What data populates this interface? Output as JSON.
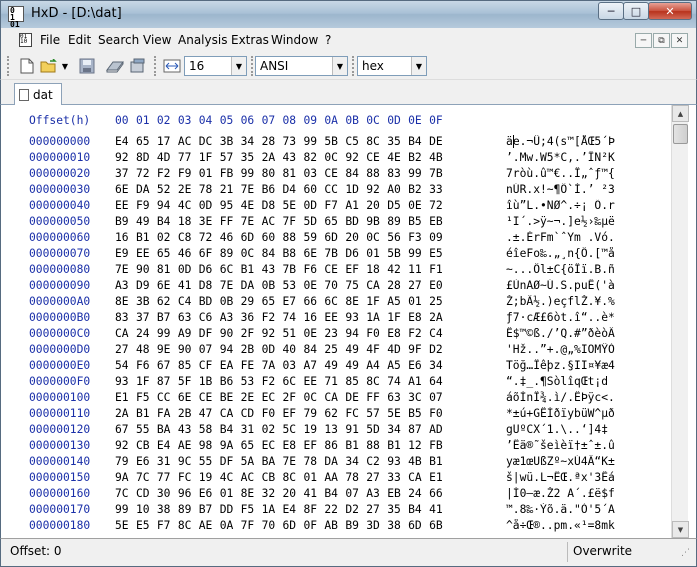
{
  "window": {
    "title": "HxD - [D:\\dat]"
  },
  "menu": [
    "File",
    "Edit",
    "Search",
    "View",
    "Analysis",
    "Extras",
    "Window",
    "?"
  ],
  "toolbar": {
    "bytes_per_row": "16",
    "charset": "ANSI",
    "offset_base": "hex"
  },
  "tabs": [
    {
      "label": "dat"
    }
  ],
  "editor": {
    "offset_header": "Offset(h)",
    "column_headers": [
      "00",
      "01",
      "02",
      "03",
      "04",
      "05",
      "06",
      "07",
      "08",
      "09",
      "0A",
      "0B",
      "0C",
      "0D",
      "0E",
      "0F"
    ],
    "rows": [
      {
        "offset": "000000000",
        "hex": "E4 65 17 AC DC 3B 34 28 73 99 5B C5 8C 35 B4 DE",
        "text": "äe.¬Ü;4(s™[ÅŒ5´Þ"
      },
      {
        "offset": "000000010",
        "hex": "92 8D 4D 77 1F 57 35 2A 43 82 0C 92 CE 4E B2 4B",
        "text": "’.Mw.W5*C‚.’ÎN²K"
      },
      {
        "offset": "000000020",
        "hex": "37 72 F2 F9 01 FB 99 80 81 03 CE 84 88 83 99 7B",
        "text": "7ròù.û™€..Î„ˆƒ™{"
      },
      {
        "offset": "000000030",
        "hex": "6E DA 52 2E 78 21 7E B6 D4 60 CC 1D 92 A0 B2 33",
        "text": "nÚR.x!~¶Ô`Ì.’ ²3"
      },
      {
        "offset": "000000040",
        "hex": "EE F9 94 4C 0D 95 4E D8 5E 0D F7 A1 20 D5 0E 72",
        "text": "îù”L.•NØ^.÷¡ Õ.r"
      },
      {
        "offset": "000000050",
        "hex": "B9 49 B4 18 3E FF 7E AC 7F 5D 65 BD 9B 89 B5 EB",
        "text": "¹I´.>ÿ~¬.]e½›‰µë"
      },
      {
        "offset": "000000060",
        "hex": "16 B1 02 C8 72 46 6D 60 88 59 6D 20 0C 56 F3 09",
        "text": ".±.ÈrFm`ˆYm .Vó."
      },
      {
        "offset": "000000070",
        "hex": "E9 EE 65 46 6F 89 0C 84 B8 6E 7B D6 01 5B 99 E5",
        "text": "éîeFo‰.„¸n{Ö.[™å"
      },
      {
        "offset": "000000080",
        "hex": "7E 90 81 0D D6 6C B1 43 7B F6 CE EF 18 42 11 F1",
        "text": "~...Öl±C{öÎï.B.ñ"
      },
      {
        "offset": "000000090",
        "hex": "A3 D9 6E 41 D8 7E DA 0B 53 0E 70 75 CA 28 27 E0",
        "text": "£ÙnAØ~Ú.S.puÊ('à"
      },
      {
        "offset": "0000000A0",
        "hex": "8E 3B 62 C4 BD 0B 29 65 E7 66 6C 8E 1F A5 01 25",
        "text": "Ž;bÄ½.)eçflŽ.¥.%"
      },
      {
        "offset": "0000000B0",
        "hex": "83 37 B7 63 C6 A3 36 F2 74 16 EE 93 1A 1F E8 2A",
        "text": "ƒ7·cÆ£6òt.î“..è*"
      },
      {
        "offset": "0000000C0",
        "hex": "CA 24 99 A9 DF 90 2F 92 51 0E 23 94 F0 E8 F2 C4",
        "text": "Ê$™©ß./’Q.#”ðèòÄ"
      },
      {
        "offset": "0000000D0",
        "hex": "27 48 9E 90 07 94 2B 0D 40 84 25 49 4F 4D 9F D2",
        "text": "'Hž..”+.@„%IOMŸÒ"
      },
      {
        "offset": "0000000E0",
        "hex": "54 F6 67 85 CF EA FE 7A 03 A7 49 49 A4 A5 E6 34",
        "text": "Töğ…Ïêþz.§II¤¥æ4"
      },
      {
        "offset": "0000000F0",
        "hex": "93 1F 87 5F 1B B6 53 F2 6C EE 71 85 8C 74 A1 64",
        "text": "“.‡_.¶SòlîqŒt¡d"
      },
      {
        "offset": "000000100",
        "hex": "E1 F5 CC 6E CE BE 2E EC 2F 0C CA DE FF 63 3C 07",
        "text": "áõÌnÎ¾.ì/.ÊÞÿc<."
      },
      {
        "offset": "000000110",
        "hex": "2A B1 FA 2B 47 CA CD F0 EF 79 62 FC 57 5E B5 F0",
        "text": "*±ú+GÊÍðïybüW^µð"
      },
      {
        "offset": "000000120",
        "hex": "67 55 BA 43 58 B4 31 02 5C 19 13 91 5D 34 87 AD",
        "text": "gUºCX´1.\\..‘]4‡­"
      },
      {
        "offset": "000000130",
        "hex": "92 CB E4 AE 98 9A 65 EC E8 EF 86 B1 88 B1 12 FB",
        "text": "’Ëä®˜šeìèï†±ˆ±.û"
      },
      {
        "offset": "000000140",
        "hex": "79 E6 31 9C 55 DF 5A BA 7E 78 DA 34 C2 93 4B B1",
        "text": "yæ1œUßZº~xÚ4Â“K±"
      },
      {
        "offset": "000000150",
        "hex": "9A 7C 77 FC 19 4C AC CB 8C 01 AA 78 27 33 CA E1",
        "text": "š|wü.L¬ËŒ.ªx'3Êá"
      },
      {
        "offset": "000000160",
        "hex": "7C CD 30 96 E6 01 8E 32 20 41 B4 07 A3 EB 24 66",
        "text": "|Í0–æ.Ž2 A´.£ë$f"
      },
      {
        "offset": "000000170",
        "hex": "99 10 38 89 B7 DD F5 1A E4 8F 22 D2 27 35 B4 41",
        "text": "™.8‰·Ýõ.ä.\"Ò'5´A"
      },
      {
        "offset": "000000180",
        "hex": "5E E5 F7 8C AE 0A 7F 70 6D 0F AB B9 3D 38 6D 6B",
        "text": "^å÷Œ®..pm.«¹=8mk"
      }
    ]
  },
  "status": {
    "offset": "Offset: 0",
    "mode": "Overwrite"
  }
}
